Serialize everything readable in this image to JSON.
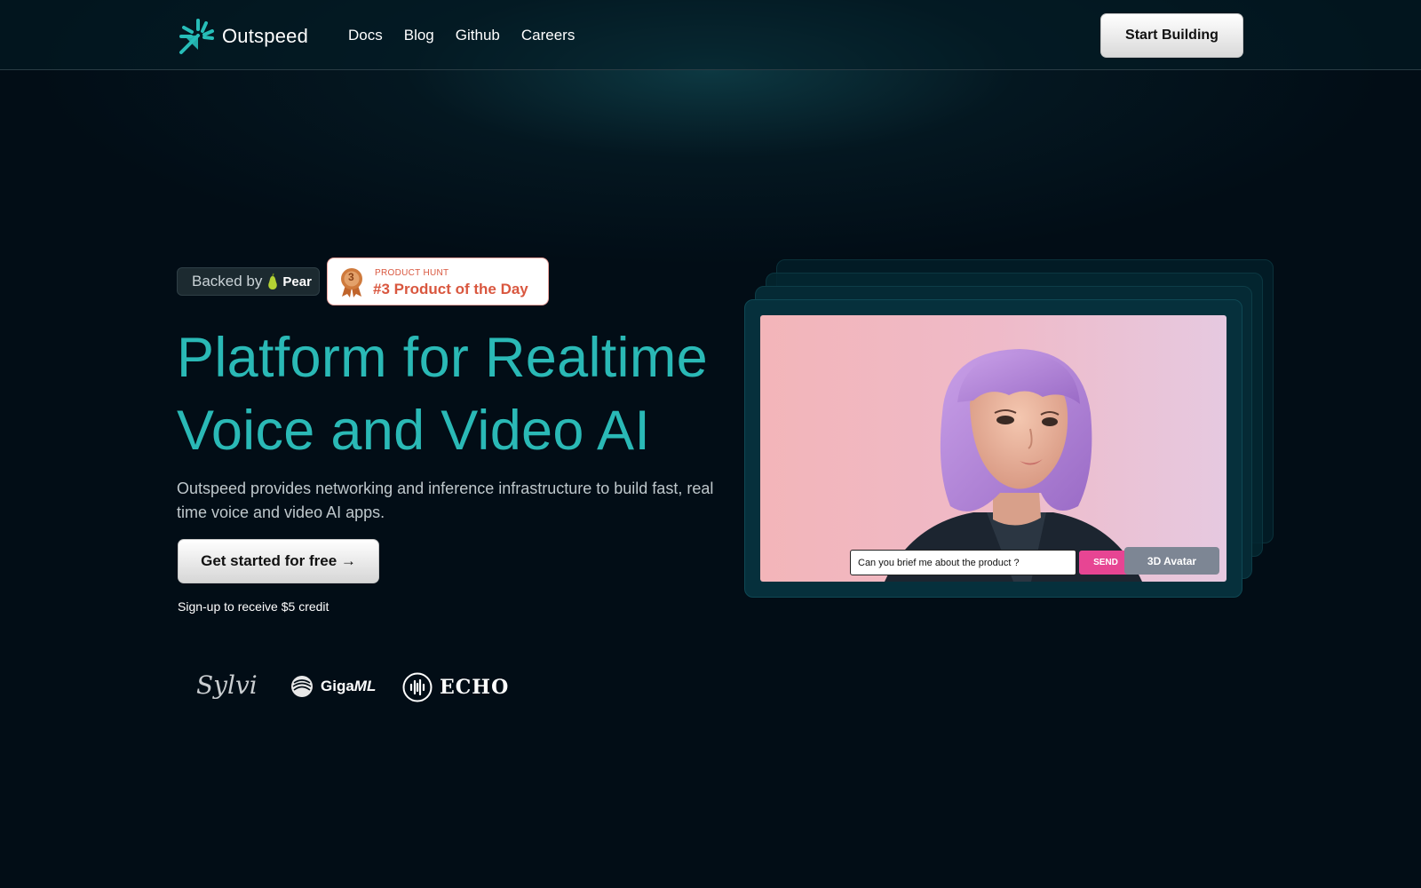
{
  "nav": {
    "brand": "Outspeed",
    "links": [
      "Docs",
      "Blog",
      "Github",
      "Careers"
    ],
    "cta": "Start Building"
  },
  "badges": {
    "backed_prefix": "Backed by",
    "backed_name": "Pear",
    "ph_label": "PRODUCT HUNT",
    "ph_rank": "#3 Product of the Day",
    "medal_number": "3"
  },
  "hero": {
    "headline_line1": "Platform for Realtime",
    "headline_line2": "Voice and Video AI",
    "subtext": "Outspeed provides networking and inference infrastructure to build fast, real time voice and video AI apps.",
    "cta": "Get started for free →",
    "credit_note": "Sign-up to receive $5 credit"
  },
  "customers": {
    "sylvi": "Sylvi",
    "gigaml_a": "Giga",
    "gigaml_b": "ML",
    "echo": "ECHO"
  },
  "demo": {
    "input_value": "Can you brief me about the product ?",
    "send_label": "SEND",
    "avatar_label": "3D Avatar"
  },
  "colors": {
    "background": "#020d16",
    "headline": "#2ab9b6",
    "accent_send": "#e74593",
    "product_hunt": "#d9573f"
  }
}
